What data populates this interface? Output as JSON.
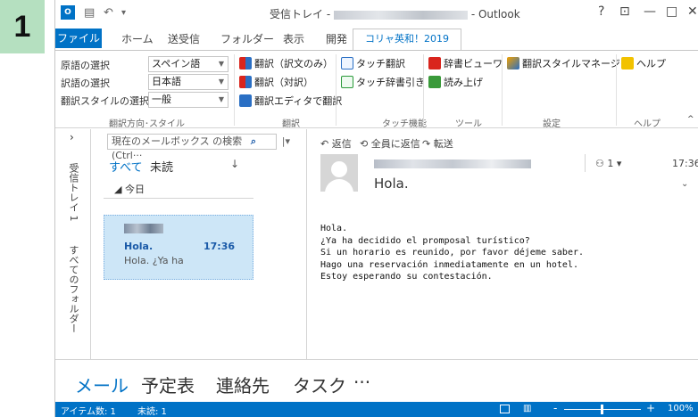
{
  "step_number": "1",
  "titlebar": {
    "title_prefix": "受信トレイ -",
    "title_suffix": "- Outlook",
    "help": "?",
    "restore": "⊡",
    "minimize": "—",
    "maximize": "□",
    "close": "✕"
  },
  "tabs": [
    "ファイル",
    "ホーム",
    "送受信",
    "フォルダー",
    "表示",
    "開発",
    "コリャ英和！2019"
  ],
  "ribbon": {
    "source_lang_label": "原語の選択",
    "source_lang_value": "スペイン語",
    "target_lang_label": "訳語の選択",
    "target_lang_value": "日本語",
    "style_label": "翻訳スタイルの選択",
    "style_value": "一般",
    "group1": "翻訳方向･スタイル",
    "translate_only": "翻訳（訳文のみ）",
    "translate_pair": "翻訳（対訳）",
    "translate_editor": "翻訳エディタで翻訳",
    "group2": "翻訳",
    "touch_translate": "タッチ翻訳",
    "touch_dict": "タッチ辞書引き",
    "group3": "タッチ機能",
    "dict_viewer": "辞書ビューワ",
    "read_aloud": "読み上げ",
    "group4": "ツール",
    "style_manager": "翻訳スタイルマネージャ",
    "group5": "設定",
    "help": "ヘルプ",
    "group6": "ヘルプ"
  },
  "nav": {
    "inbox": "受信トレイ 1",
    "all_folders": "すべてのフォルダー"
  },
  "msglist": {
    "search_placeholder": "現在のメールボックス の検索 (Ctrl···",
    "filter_all": "すべて",
    "filter_unread": "未読",
    "sort": "↓",
    "group_today": "◢ 今日",
    "item_subject": "Hola.",
    "item_time": "17:36",
    "item_preview": "Hola. ¿Ya ha"
  },
  "reading": {
    "reply": "返信",
    "reply_all": "全員に返信",
    "forward": "転送",
    "people_count": "1",
    "time": "17:36",
    "subject": "Hola.",
    "body": "Hola.\n¿Ya ha decidido el promposal turístico?\nSi un horario es reunido, por favor déjeme saber.\nHago una reservación inmediatamente en un hotel.\nEstoy esperando su contestación."
  },
  "bottomnav": {
    "mail": "メール",
    "calendar": "予定表",
    "contacts": "連絡先",
    "tasks": "タスク",
    "more": "···"
  },
  "status": {
    "items": "アイテム数: 1",
    "unread": "未読: 1",
    "zoom": "100%"
  },
  "colors": {
    "accent": "#0072c6",
    "selected_item": "#cde6f7",
    "step_badge": "#b5e0c0"
  }
}
